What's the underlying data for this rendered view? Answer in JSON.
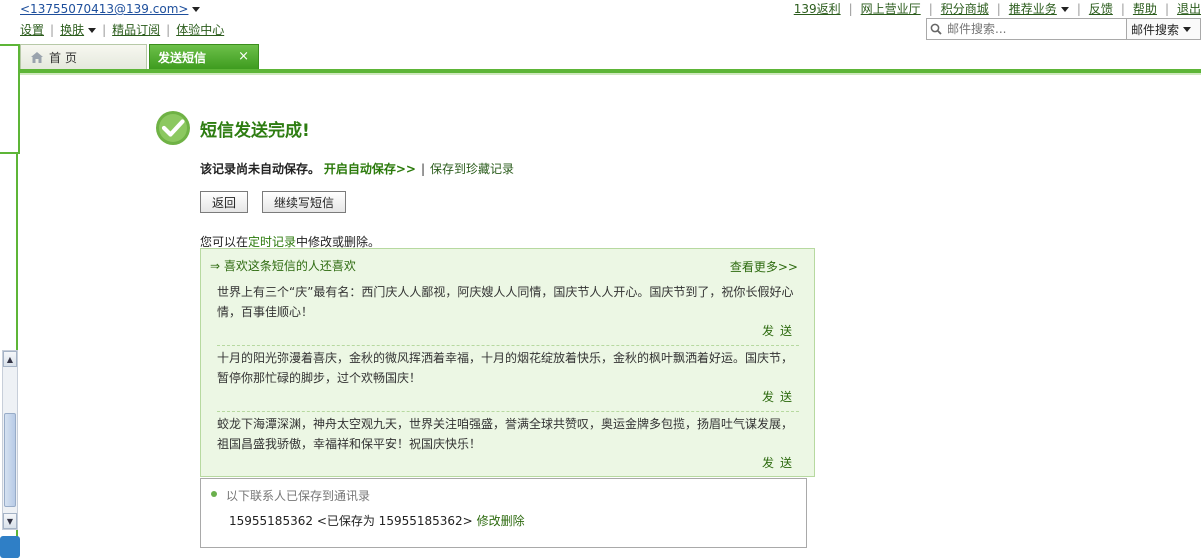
{
  "header": {
    "account": "<13755070413@139.com>",
    "links": [
      "设置",
      "换肤",
      "精品订阅",
      "体验中心"
    ],
    "right_links": [
      "139返利",
      "网上营业厅",
      "积分商城",
      "推荐业务",
      "反馈",
      "帮助",
      "退出"
    ],
    "search": {
      "placeholder": "邮件搜索...",
      "scope": "邮件搜索"
    }
  },
  "tabs": {
    "home": "首页",
    "current": "发送短信",
    "close": "×"
  },
  "result": {
    "title": "短信发送完成!",
    "not_saved": "该记录尚未自动保存。",
    "enable_autosave": "开启自动保存>>",
    "save_to_collection": "保存到珍藏记录"
  },
  "buttons": {
    "back": "返回",
    "continue": "继续写短信"
  },
  "tip": {
    "before": "您可以在",
    "link": "定时记录",
    "after": "中修改或删除。"
  },
  "recommend": {
    "title": "⇒ 喜欢这条短信的人还喜欢",
    "more": "查看更多>>",
    "send_label": "发送",
    "items": [
      "世界上有三个“庆”最有名：西门庆人人鄙视，阿庆嫂人人同情，国庆节人人开心。国庆节到了，祝你长假好心情，百事佳顺心！",
      "十月的阳光弥漫着喜庆，金秋的微风挥洒着幸福，十月的烟花绽放着快乐，金秋的枫叶飘洒着好运。国庆节，暂停你那忙碌的脚步，过个欢畅国庆！",
      "蛟龙下海潭深渊，神舟太空观九天，世界关注咱强盛，誉满全球共赞叹，奥运金牌多包揽，扬眉吐气谋发展，祖国昌盛我骄傲，幸福祥和保平安！祝国庆快乐！"
    ]
  },
  "saved_contacts": {
    "header": "以下联系人已保存到通讯录",
    "number": "15955185362",
    "saved_as": "<已保存为 15955185362>",
    "edit": "修改删除"
  }
}
